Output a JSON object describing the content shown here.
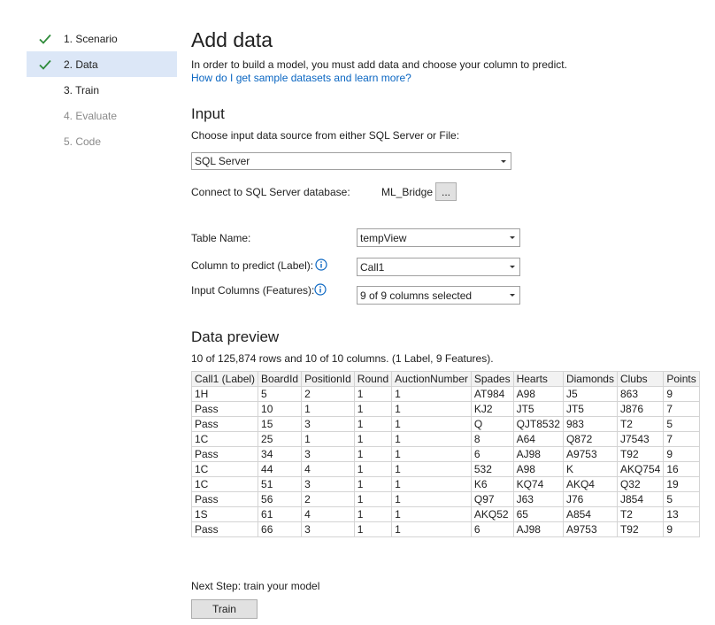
{
  "steps": [
    {
      "label": "1. Scenario",
      "state": "done"
    },
    {
      "label": "2. Data",
      "state": "active"
    },
    {
      "label": "3. Train",
      "state": "pending"
    },
    {
      "label": "4. Evaluate",
      "state": "disabled"
    },
    {
      "label": "5. Code",
      "state": "disabled"
    }
  ],
  "page": {
    "title": "Add data",
    "intro": "In order to build a model, you must add data and choose your column to predict.",
    "help_link": "How do I get sample datasets and learn more?"
  },
  "input": {
    "heading": "Input",
    "source_prompt": "Choose input data source from either SQL Server or File:",
    "source_value": "SQL Server",
    "connect_label": "Connect to SQL Server database:",
    "database_name": "ML_Bridge",
    "browse_label": "...",
    "table_label": "Table Name:",
    "table_value": "tempView",
    "predict_label": "Column to predict (Label):",
    "predict_value": "Call1",
    "features_label": "Input Columns (Features):",
    "features_value": "9 of 9 columns selected"
  },
  "preview": {
    "heading": "Data preview",
    "summary": "10 of 125,874 rows and 10 of 10 columns. (1 Label, 9 Features).",
    "columns": [
      "Call1 (Label)",
      "BoardId",
      "PositionId",
      "Round",
      "AuctionNumber",
      "Spades",
      "Hearts",
      "Diamonds",
      "Clubs",
      "Points"
    ],
    "rows": [
      [
        "1H",
        "5",
        "2",
        "1",
        "1",
        "AT984",
        "A98",
        "J5",
        "863",
        "9"
      ],
      [
        "Pass",
        "10",
        "1",
        "1",
        "1",
        "KJ2",
        "JT5",
        "JT5",
        "J876",
        "7"
      ],
      [
        "Pass",
        "15",
        "3",
        "1",
        "1",
        "Q",
        "QJT8532",
        "983",
        "T2",
        "5"
      ],
      [
        "1C",
        "25",
        "1",
        "1",
        "1",
        "8",
        "A64",
        "Q872",
        "J7543",
        "7"
      ],
      [
        "Pass",
        "34",
        "3",
        "1",
        "1",
        "6",
        "AJ98",
        "A9753",
        "T92",
        "9"
      ],
      [
        "1C",
        "44",
        "4",
        "1",
        "1",
        "532",
        "A98",
        "K",
        "AKQ754",
        "16"
      ],
      [
        "1C",
        "51",
        "3",
        "1",
        "1",
        "K6",
        "KQ74",
        "AKQ4",
        "Q32",
        "19"
      ],
      [
        "Pass",
        "56",
        "2",
        "1",
        "1",
        "Q97",
        "J63",
        "J76",
        "J854",
        "5"
      ],
      [
        "1S",
        "61",
        "4",
        "1",
        "1",
        "AKQ52",
        "65",
        "A854",
        "T2",
        "13"
      ],
      [
        "Pass",
        "66",
        "3",
        "1",
        "1",
        "6",
        "AJ98",
        "A9753",
        "T92",
        "9"
      ]
    ]
  },
  "footer": {
    "next_step": "Next Step: train your model",
    "train_button": "Train"
  },
  "colors": {
    "accent": "#0a66c2",
    "check": "#2e8b3a",
    "active_bg": "#dce7f7"
  }
}
